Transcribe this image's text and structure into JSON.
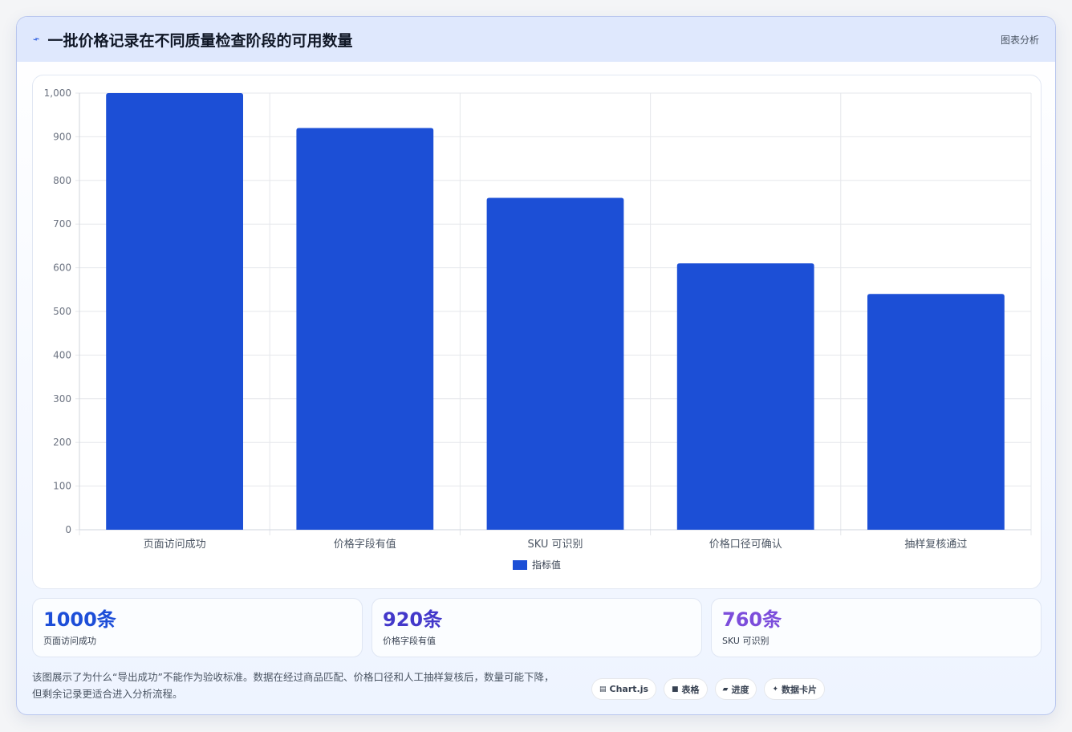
{
  "header": {
    "icon": "chart-line-icon",
    "title": "一批价格记录在不同质量检查阶段的可用数量",
    "right_label": "图表分析"
  },
  "chart_data": {
    "type": "bar",
    "categories": [
      "页面访问成功",
      "价格字段有值",
      "SKU 可识别",
      "价格口径可确认",
      "抽样复核通过"
    ],
    "series": [
      {
        "name": "指标值",
        "values": [
          1000,
          920,
          760,
          610,
          540
        ],
        "color": "#1c4fd6"
      }
    ],
    "ylim": [
      0,
      1000
    ],
    "yticks": [
      0,
      100,
      200,
      300,
      400,
      500,
      600,
      700,
      800,
      900,
      1000
    ],
    "ytick_labels": [
      "0",
      "100",
      "200",
      "300",
      "400",
      "500",
      "600",
      "700",
      "800",
      "900",
      "1,000"
    ],
    "grid": true,
    "legend": "bottom"
  },
  "stats": [
    {
      "value": "1000条",
      "label": "页面访问成功",
      "color": "#1d4ed8"
    },
    {
      "value": "920条",
      "label": "价格字段有值",
      "color": "#4338ca"
    },
    {
      "value": "760条",
      "label": "SKU 可识别",
      "color": "#7c4ddb"
    }
  ],
  "description": {
    "line1": "该图展示了为什么“导出成功”不能作为验收标准。数据在经过商品匹配、价格口径和人工抽样复核后，数量可能下降，",
    "line2": "但剩余记录更适合进入分析流程。"
  },
  "tags": [
    {
      "icon": "save-icon",
      "label": "Chart.js"
    },
    {
      "icon": "table-icon",
      "label": "表格"
    },
    {
      "icon": "progress-icon",
      "label": "进度"
    },
    {
      "icon": "sparkle-icon",
      "label": "数据卡片"
    }
  ]
}
